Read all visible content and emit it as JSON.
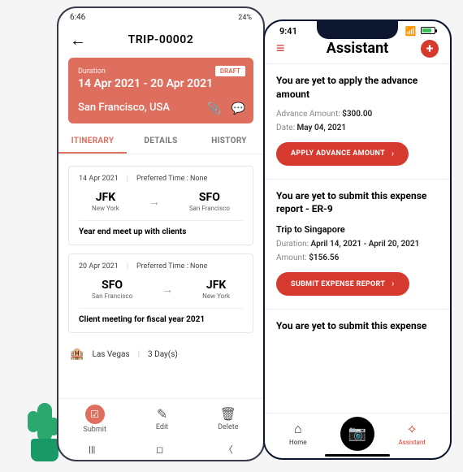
{
  "phone1": {
    "status": {
      "time": "6:46",
      "battery": "24%"
    },
    "title": "TRIP-00002",
    "trip": {
      "duration_label": "Duration",
      "dates": "14 Apr 2021 - 20 Apr 2021",
      "city": "San Francisco, USA",
      "badge": "DRAFT"
    },
    "tabs": {
      "itinerary": "ITINERARY",
      "details": "DETAILS",
      "history": "HISTORY"
    },
    "legs": [
      {
        "date": "14 Apr 2021",
        "pref": "Preferred Time : None",
        "from_code": "JFK",
        "from_name": "New York",
        "to_code": "SFO",
        "to_name": "San Francisco",
        "title": "Year end meet up with clients"
      },
      {
        "date": "20 Apr 2021",
        "pref": "Preferred Time : None",
        "from_code": "SFO",
        "from_name": "San Francisco",
        "to_code": "JFK",
        "to_name": "New York",
        "title": "Client meeting for fiscal year 2021"
      }
    ],
    "strip": {
      "city": "Las Vegas",
      "duration": "3 Day(s)"
    },
    "actions": {
      "submit": "Submit",
      "edit": "Edit",
      "delete": "Delete"
    }
  },
  "phone2": {
    "status": {
      "time": "9:41"
    },
    "title": "Assistant",
    "cards": [
      {
        "title": "You are yet to apply the advance amount",
        "advance_label": "Advance Amount:",
        "advance": "$300.00",
        "date_label": "Date:",
        "date": "May 04, 2021",
        "button": "APPLY ADVANCE AMOUNT"
      },
      {
        "title": "You are yet to submit this expense report - ER-9",
        "subtitle": "Trip to Singapore",
        "duration_label": "Duration:",
        "duration": "April 14, 2021 - April 20, 2021",
        "amount_label": "Amount:",
        "amount": "$156.56",
        "button": "SUBMIT EXPENSE REPORT"
      },
      {
        "title": "You are yet to submit this expense"
      }
    ],
    "nav": {
      "home": "Home",
      "assistant": "Assistant"
    }
  }
}
